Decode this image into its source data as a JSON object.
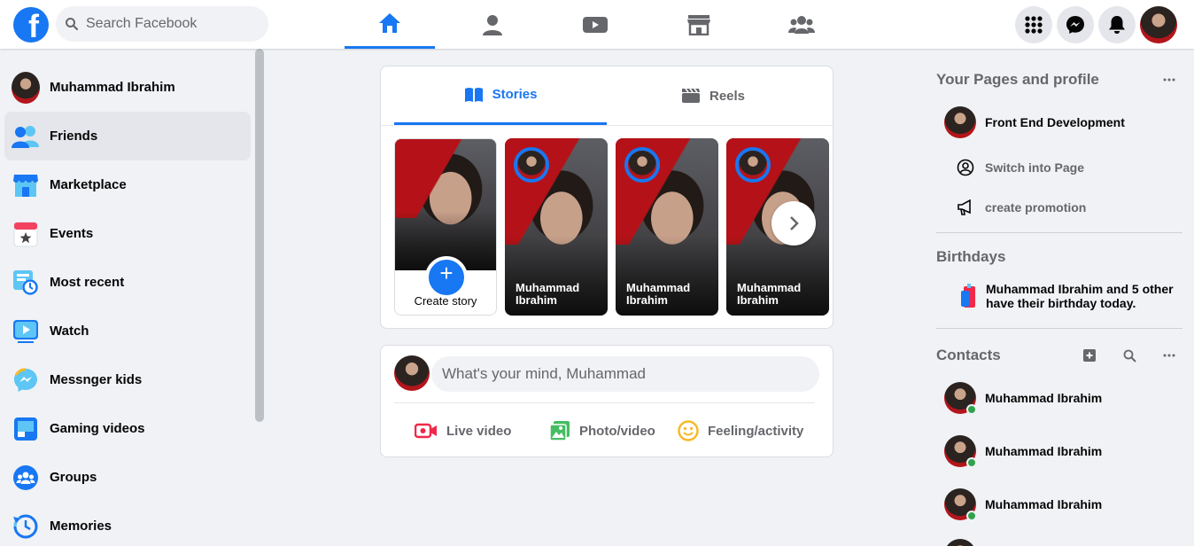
{
  "header": {
    "logo_letter": "f",
    "search_placeholder": "Search Facebook",
    "nav_tabs": [
      {
        "name": "home",
        "icon": "home-icon",
        "active": true
      },
      {
        "name": "profile",
        "icon": "person-icon",
        "active": false
      },
      {
        "name": "watch",
        "icon": "video-icon",
        "active": false
      },
      {
        "name": "marketplace",
        "icon": "store-icon",
        "active": false
      },
      {
        "name": "groups",
        "icon": "groups-icon",
        "active": false
      }
    ],
    "right_buttons": [
      "menu-grid-icon",
      "messenger-icon",
      "bell-icon",
      "account-avatar"
    ]
  },
  "sidebar": {
    "items": [
      {
        "label": "Muhammad Ibrahim",
        "icon": "profile-avatar"
      },
      {
        "label": "Friends",
        "icon": "friends-icon",
        "active": true
      },
      {
        "label": "Marketplace",
        "icon": "marketplace-icon"
      },
      {
        "label": "Events",
        "icon": "events-icon"
      },
      {
        "label": "Most recent",
        "icon": "most-recent-icon"
      },
      {
        "label": "Watch",
        "icon": "watch-icon"
      },
      {
        "label": "Messnger kids",
        "icon": "messenger-kids-icon"
      },
      {
        "label": "Gaming videos",
        "icon": "gaming-icon"
      },
      {
        "label": "Groups",
        "icon": "groups-icon"
      },
      {
        "label": "Memories",
        "icon": "memories-icon"
      }
    ]
  },
  "stories": {
    "tabs": [
      {
        "label": "Stories",
        "icon": "book-icon",
        "active": true
      },
      {
        "label": "Reels",
        "icon": "clapperboard-icon",
        "active": false
      }
    ],
    "create_label": "Create story",
    "items": [
      {
        "name": "Muhammad Ibrahim"
      },
      {
        "name": "Muhammad Ibrahim"
      },
      {
        "name": "Muhammad Ibrahim"
      }
    ]
  },
  "composer": {
    "placeholder": "What's your mind, Muhammad",
    "actions": [
      {
        "label": "Live video",
        "icon": "live-video-icon",
        "color": "#f02849"
      },
      {
        "label": "Photo/video",
        "icon": "photo-icon",
        "color": "#45bd62"
      },
      {
        "label": "Feeling/activity",
        "icon": "smiley-icon",
        "color": "#f7b928"
      }
    ]
  },
  "right": {
    "pages_title": "Your Pages and profile",
    "page_name": "Front End Development",
    "switch_label": "Switch into Page",
    "promotion_label": "create promotion",
    "birthdays_title": "Birthdays",
    "birthday_text": "Muhammad Ibrahim and 5 other have their birthday today.",
    "contacts_title": "Contacts",
    "contacts": [
      {
        "name": "Muhammad Ibrahim",
        "online": true
      },
      {
        "name": "Muhammad Ibrahim",
        "online": true
      },
      {
        "name": "Muhammad Ibrahim",
        "online": true
      }
    ]
  },
  "colors": {
    "brand": "#1877f2",
    "background": "#f0f2f5",
    "online": "#31a24c"
  }
}
